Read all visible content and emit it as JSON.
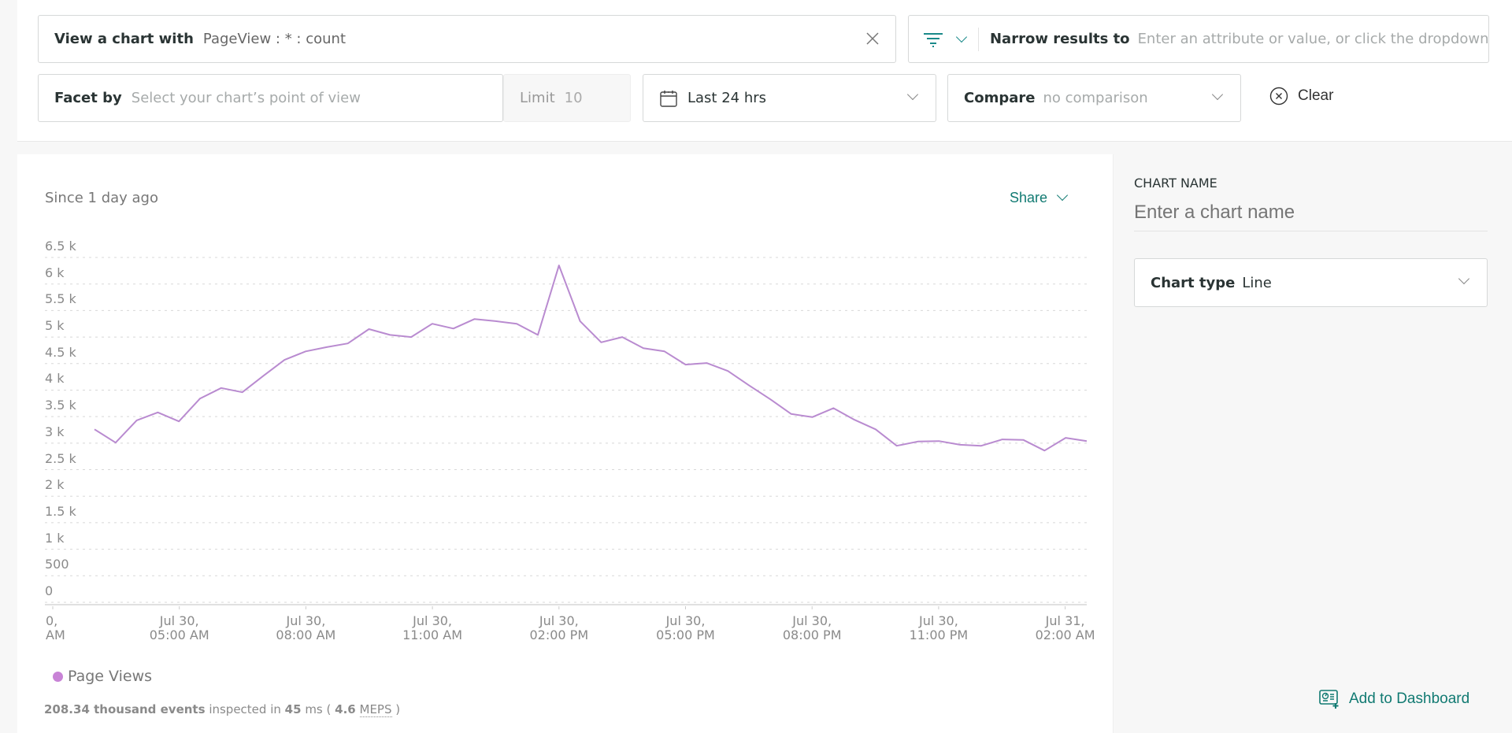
{
  "query": {
    "view_label": "View a chart with",
    "view_value": "PageView : * : count",
    "narrow_label": "Narrow results to",
    "narrow_placeholder": "Enter an attribute or value, or click the dropdown for",
    "facet_label": "Facet by",
    "facet_placeholder": "Select your chart’s point of view",
    "limit_label": "Limit",
    "limit_value": "10",
    "time_range": "Last 24 hrs",
    "compare_label": "Compare",
    "compare_value": "no comparison",
    "clear_label": "Clear"
  },
  "chart_header": {
    "since": "Since 1 day ago",
    "share_label": "Share"
  },
  "sidebar": {
    "chart_name_label": "CHART NAME",
    "chart_name_placeholder": "Enter a chart name",
    "chart_type_label": "Chart type",
    "chart_type_value": "Line",
    "add_dashboard_label": "Add to Dashboard"
  },
  "footer": {
    "events": "208.34 thousand events",
    "inspected_in": "inspected in",
    "ms_value": "45",
    "ms_unit": "ms (",
    "meps_value": "4.6",
    "meps_label": "MEPS",
    "close_paren": ")"
  },
  "colors": {
    "series": "#b98bd0",
    "accent": "#117a72",
    "legend_dot": "#c883d6"
  },
  "chart_data": {
    "type": "line",
    "title": "Since 1 day ago",
    "xlabel": "",
    "ylabel": "",
    "ylim": [
      0,
      6500
    ],
    "grid": true,
    "legend_position": "bottom-left",
    "yticks": [
      "0",
      "500",
      "1 k",
      "1.5 k",
      "2 k",
      "2.5 k",
      "3 k",
      "3.5 k",
      "4 k",
      "4.5 k",
      "5 k",
      "5.5 k",
      "6 k",
      "6.5 k"
    ],
    "ytick_values": [
      0,
      500,
      1000,
      1500,
      2000,
      2500,
      3000,
      3500,
      4000,
      4500,
      5000,
      5500,
      6000,
      6500
    ],
    "xticks": [
      {
        "line1": "0,",
        "line2": "AM",
        "hour": 2
      },
      {
        "line1": "Jul 30,",
        "line2": "05:00 AM",
        "hour": 5
      },
      {
        "line1": "Jul 30,",
        "line2": "08:00 AM",
        "hour": 8
      },
      {
        "line1": "Jul 30,",
        "line2": "11:00 AM",
        "hour": 11
      },
      {
        "line1": "Jul 30,",
        "line2": "02:00 PM",
        "hour": 14
      },
      {
        "line1": "Jul 30,",
        "line2": "05:00 PM",
        "hour": 17
      },
      {
        "line1": "Jul 30,",
        "line2": "08:00 PM",
        "hour": 20
      },
      {
        "line1": "Jul 30,",
        "line2": "11:00 PM",
        "hour": 23
      },
      {
        "line1": "Jul 31,",
        "line2": "02:00 AM",
        "hour": 26
      }
    ],
    "x_range_hours": [
      2,
      26.8
    ],
    "series": [
      {
        "name": "Page Views",
        "x_hours": [
          3.2,
          3.8,
          4.4,
          5.0,
          5.6,
          6.2,
          6.8,
          7.4,
          8.0,
          8.6,
          9.2,
          9.8,
          10.4,
          11.0,
          11.6,
          12.2,
          12.8,
          13.4,
          14.0,
          14.6,
          15.3,
          15.9,
          16.5,
          17.1,
          17.7,
          18.3,
          18.9,
          19.5,
          20.1,
          20.7,
          21.3,
          21.9,
          22.5,
          23.1,
          23.7,
          24.3,
          24.9,
          25.5,
          26.1,
          26.7,
          27.3,
          27.9,
          28.5,
          29.1,
          29.7,
          30.3,
          30.9,
          31.6
        ],
        "values": [
          3260,
          3010,
          3430,
          3580,
          3410,
          3840,
          4040,
          3960,
          4270,
          4570,
          4730,
          4810,
          4880,
          5150,
          5040,
          5000,
          5250,
          5160,
          5340,
          5300,
          5250,
          5040,
          6350,
          5300,
          4900,
          5000,
          4790,
          4730,
          4480,
          4510,
          4360,
          4090,
          3830,
          3550,
          3490,
          3660,
          3440,
          3260,
          2950,
          3030,
          3040,
          2970,
          2950,
          3070,
          3060,
          2860,
          3100,
          3040
        ]
      }
    ]
  }
}
